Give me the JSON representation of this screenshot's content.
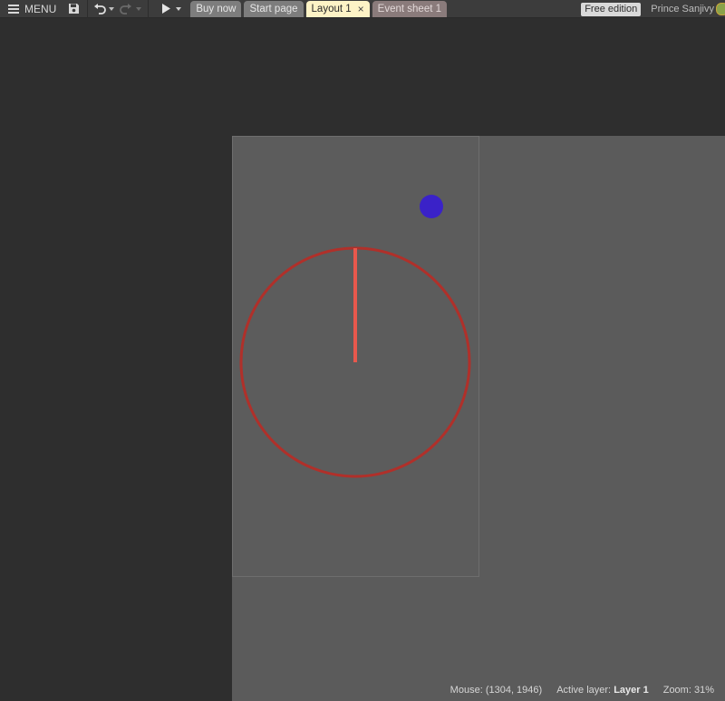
{
  "toolbar": {
    "menu_label": "MENU",
    "icons": {
      "menu": "hamburger-icon",
      "save": "save-icon",
      "undo": "undo-icon",
      "redo": "redo-icon",
      "play": "play-icon",
      "dropdown": "caret-down-icon"
    }
  },
  "tabs": [
    {
      "label": "Buy now",
      "style": "gray"
    },
    {
      "label": "Start page",
      "style": "gray"
    },
    {
      "label": "Layout 1",
      "style": "active",
      "close": "×"
    },
    {
      "label": "Event sheet 1",
      "style": "event"
    }
  ],
  "account": {
    "edition_badge": "Free edition",
    "user_name": "Prince Sanjivy"
  },
  "canvas": {
    "colors": {
      "workspace": "#2e2e2e",
      "layout_background": "#5b5b5b",
      "circle_stroke": "#b0302a",
      "needle": "#e8584d",
      "dot": "#3a22c8"
    }
  },
  "status": {
    "mouse_label": "Mouse:",
    "mouse_value": "(1304, 1946)",
    "active_layer_label": "Active layer:",
    "active_layer_value": "Layer 1",
    "zoom_label": "Zoom:",
    "zoom_value": "31%"
  }
}
